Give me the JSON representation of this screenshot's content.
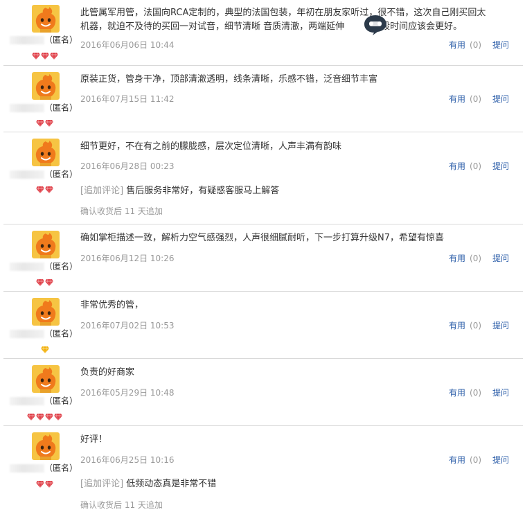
{
  "reviews": [
    {
      "text": "此管属军用管，法国向RCA定制的，典型的法国包装，年初在朋友家听过，很不错，这次自己刚买回太机器，就迫不及待的买回一对试音，细节清晰 音质清澈，两端延伸      煲段时间应该会更好。",
      "line1": "此管属军用管，法国向RCA定制的，典型的法国包装，年初在朋友家听过，很不错，这次自己刚买回太",
      "line2": "机器，就迫不及待的买回一对试音，细节清晰 音质清澈，两端延伸",
      "line2b": "煲段时间应该会更好。",
      "user": "（匿名）",
      "date": "2016年06月06日 10:44",
      "useful": "有用",
      "count": "(0)",
      "ask": "提问",
      "gems": 3,
      "gem_color": "red"
    },
    {
      "text": "原装正货，管身干净，顶部清澈透明，线条清晰，乐感不错，泛音细节丰富",
      "user": "（匿名）",
      "date": "2016年07月15日 11:42",
      "useful": "有用",
      "count": "(0)",
      "ask": "提问",
      "gems": 2,
      "gem_color": "red"
    },
    {
      "text": "细节更好，不在有之前的朦胧感，层次定位清晰，人声丰满有韵味",
      "user": "（匿名）",
      "date": "2016年06月28日 00:23",
      "useful": "有用",
      "count": "(0)",
      "ask": "提问",
      "gems": 2,
      "gem_color": "red",
      "append_tag": "[追加评论]",
      "append_text": "售后服务非常好，有疑惑客服马上解答",
      "after": "确认收货后 11 天追加"
    },
    {
      "text": "确如掌柜描述一致，解析力空气感强烈，人声很细腻耐听，下一步打算升级N7，希望有惊喜",
      "user": "（匿名）",
      "date": "2016年06月12日 10:26",
      "useful": "有用",
      "count": "(0)",
      "ask": "提问",
      "gems": 2,
      "gem_color": "red"
    },
    {
      "text": "非常优秀的管，",
      "user": "（匿名）",
      "date": "2016年07月02日 10:53",
      "useful": "有用",
      "count": "(0)",
      "ask": "提问",
      "gems": 1,
      "gem_color": "gold"
    },
    {
      "text": "负责的好商家",
      "user": "（匿名）",
      "date": "2016年05月29日 10:48",
      "useful": "有用",
      "count": "(0)",
      "ask": "提问",
      "gems": 4,
      "gem_color": "red"
    },
    {
      "text": "好评！",
      "user": "（匿名）",
      "date": "2016年06月25日 10:16",
      "useful": "有用",
      "count": "(0)",
      "ask": "提问",
      "gems": 2,
      "gem_color": "red",
      "append_tag": "[追加评论]",
      "append_text": "低频动态真是非常不错",
      "after": "确认收货后 11 天追加"
    }
  ],
  "colors": {
    "link": "#2a5ca8",
    "meta": "#999999",
    "gem_red": "#e0424b",
    "gem_gold": "#f3b20f",
    "avatar_bg": "#f6c443",
    "mascot": "#f07a1c"
  },
  "icons": {
    "avatar": "orange-mascot-avatar-icon",
    "gem": "diamond-rank-icon",
    "overlay": "wechat-bubble-icon"
  }
}
